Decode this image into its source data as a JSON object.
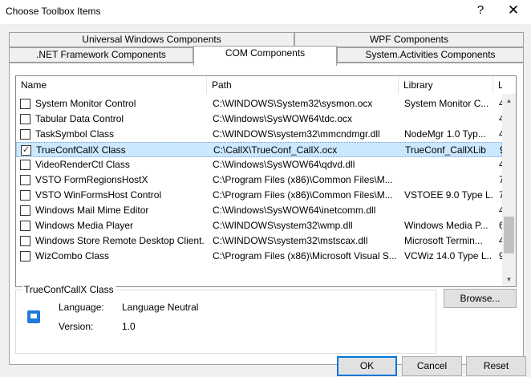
{
  "window": {
    "title": "Choose Toolbox Items",
    "help_glyph": "?",
    "close_glyph": "✕"
  },
  "tabs": {
    "row1": [
      "Universal Windows Components",
      "WPF Components"
    ],
    "row2": [
      ".NET Framework Components",
      "COM Components",
      "System.Activities Components"
    ],
    "active": "COM Components"
  },
  "list": {
    "columns": [
      "Name",
      "Path",
      "Library",
      "L"
    ],
    "rows": [
      {
        "checked": false,
        "name": "System Monitor Control",
        "path": "C:\\WINDOWS\\System32\\sysmon.ocx",
        "library": "System Monitor C...",
        "ver": "4"
      },
      {
        "checked": false,
        "name": "Tabular Data Control",
        "path": "C:\\Windows\\SysWOW64\\tdc.ocx",
        "library": "",
        "ver": "4"
      },
      {
        "checked": false,
        "name": "TaskSymbol Class",
        "path": "C:\\WINDOWS\\system32\\mmcndmgr.dll",
        "library": "NodeMgr 1.0 Typ...",
        "ver": "4"
      },
      {
        "checked": true,
        "name": "TrueConfCallX Class",
        "path": "C:\\CallX\\TrueConf_CallX.ocx",
        "library": "TrueConf_CallXLib",
        "ver": "9",
        "selected": true
      },
      {
        "checked": false,
        "name": "VideoRenderCtl Class",
        "path": "C:\\Windows\\SysWOW64\\qdvd.dll",
        "library": "",
        "ver": "4"
      },
      {
        "checked": false,
        "name": "VSTO FormRegionsHostX",
        "path": "C:\\Program Files (x86)\\Common Files\\M...",
        "library": "",
        "ver": "7"
      },
      {
        "checked": false,
        "name": "VSTO WinFormsHost Control",
        "path": "C:\\Program Files (x86)\\Common Files\\M...",
        "library": "VSTOEE 9.0 Type L...",
        "ver": "7"
      },
      {
        "checked": false,
        "name": "Windows Mail Mime Editor",
        "path": "C:\\Windows\\SysWOW64\\inetcomm.dll",
        "library": "",
        "ver": "4"
      },
      {
        "checked": false,
        "name": "Windows Media Player",
        "path": "C:\\WINDOWS\\system32\\wmp.dll",
        "library": "Windows Media P...",
        "ver": "6"
      },
      {
        "checked": false,
        "name": "Windows Store Remote Desktop Client...",
        "path": "C:\\WINDOWS\\system32\\mstscax.dll",
        "library": "Microsoft Termin...",
        "ver": "4"
      },
      {
        "checked": false,
        "name": "WizCombo Class",
        "path": "C:\\Program Files (x86)\\Microsoft Visual S...",
        "library": "VCWiz 14.0 Type L...",
        "ver": "9"
      }
    ],
    "scroll_up_glyph": "▲",
    "scroll_down_glyph": "▼",
    "scroll_position": 0.85
  },
  "info": {
    "title": "TrueConfCallX Class",
    "language_label": "Language:",
    "language_value": "Language Neutral",
    "version_label": "Version:",
    "version_value": "1.0",
    "icon": "component-icon"
  },
  "buttons": {
    "browse": "Browse...",
    "ok": "OK",
    "cancel": "Cancel",
    "reset": "Reset"
  },
  "colors": {
    "selection": "#cce8ff",
    "accent": "#0078d7",
    "icon": "#1e7bd8"
  }
}
